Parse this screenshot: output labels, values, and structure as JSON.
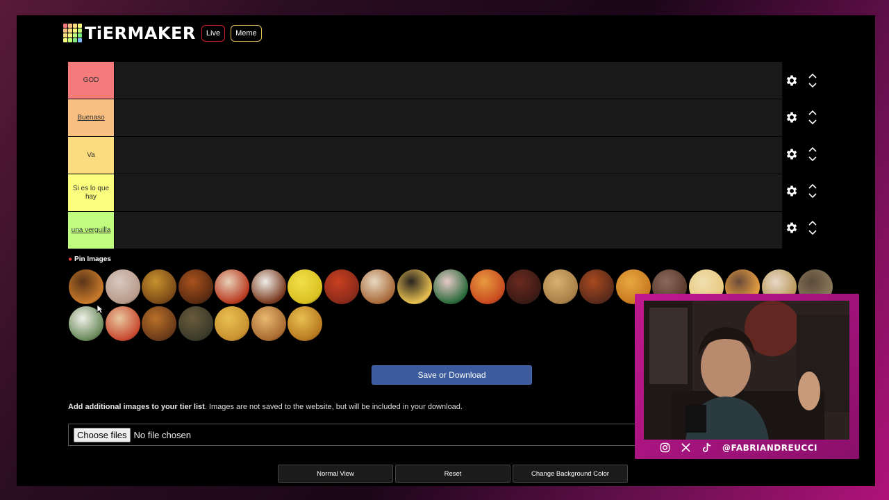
{
  "brand": {
    "name": "TiERMAKER",
    "live_label": "Live",
    "meme_label": "Meme"
  },
  "tiers": [
    {
      "label": "GOD",
      "color": "#f47a7b"
    },
    {
      "label": "Buenaso",
      "color": "#f9bf80"
    },
    {
      "label": "Va",
      "color": "#fbdd7f"
    },
    {
      "label": "Si es lo que hay",
      "color": "#fbfd7e"
    },
    {
      "label": "una verguilla",
      "color": "#c0fc7d"
    }
  ],
  "pin_images_label": "Pin Images",
  "pool_image_count": 28,
  "save_button_label": "Save or Download",
  "add_images": {
    "bold": "Add additional images to your tier list",
    "rest": ". Images are not saved to the website, but will be included in your download."
  },
  "file_input": {
    "button_label": "Choose files",
    "status": "No file chosen"
  },
  "bottom_buttons": [
    "Normal View",
    "Reset",
    "Change Background Color"
  ],
  "webcam": {
    "handle": "@FABRIANDREUCCI",
    "icons": [
      "instagram-icon",
      "x-icon",
      "tiktok-icon"
    ]
  },
  "colors": {
    "save_button": "#3b5b9d",
    "cam_frame": "#c01890",
    "live_border": "#d21f2b",
    "meme_border": "#e2c25a"
  }
}
